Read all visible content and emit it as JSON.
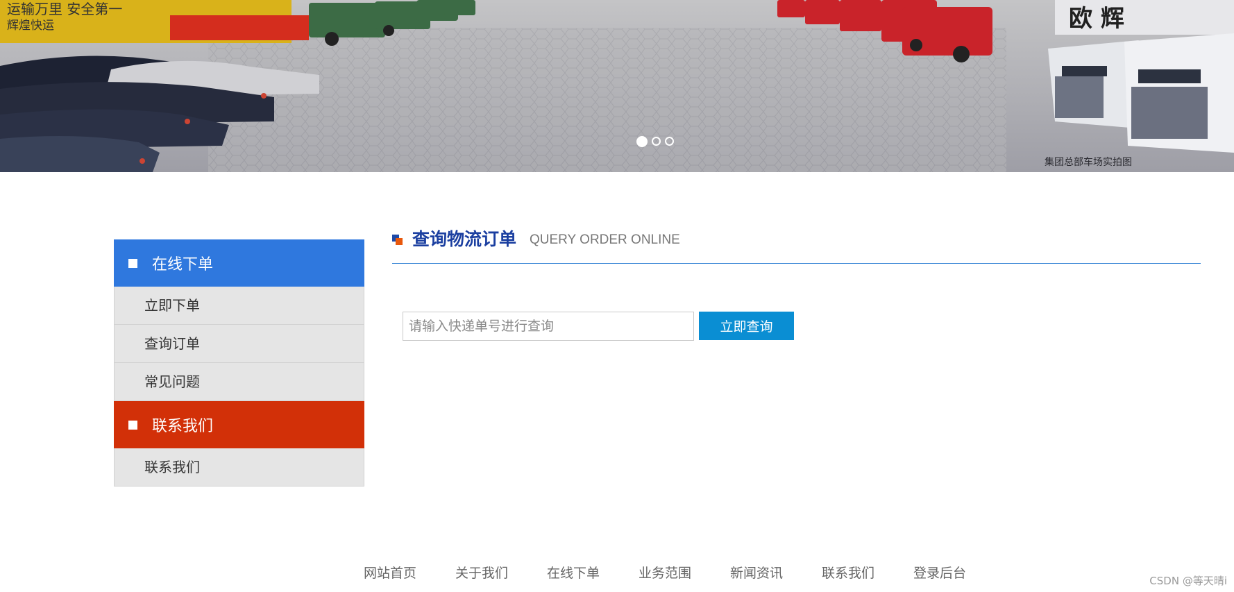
{
  "banner": {
    "sign_left": "运输万里 安全第一",
    "sign_left_sub": "辉煌快运",
    "sign_right": "欧 辉 ",
    "caption": "集团总部车场实拍图",
    "slides": [
      {
        "label": "slide-1",
        "active": true
      },
      {
        "label": "slide-2",
        "active": false
      },
      {
        "label": "slide-3",
        "active": false
      }
    ]
  },
  "sidebar": {
    "section1": {
      "title": "在线下单",
      "items": [
        "立即下单",
        "查询订单",
        "常见问题"
      ]
    },
    "section2": {
      "title": "联系我们",
      "items": [
        "联系我们"
      ]
    }
  },
  "main": {
    "title_cn": "查询物流订单",
    "title_en": "QUERY ORDER ONLINE",
    "search": {
      "placeholder": "请输入快递单号进行查询",
      "value": "",
      "button": "立即查询"
    }
  },
  "footer": {
    "links": [
      "网站首页",
      "关于我们",
      "在线下单",
      "业务范围",
      "新闻资讯",
      "联系我们",
      "登录后台"
    ]
  },
  "watermark": "CSDN @等天晴i",
  "colors": {
    "sidebar_blue": "#2f78de",
    "sidebar_red": "#d23008",
    "title_blue": "#1b3fa0",
    "button_blue": "#0a8ed3"
  }
}
